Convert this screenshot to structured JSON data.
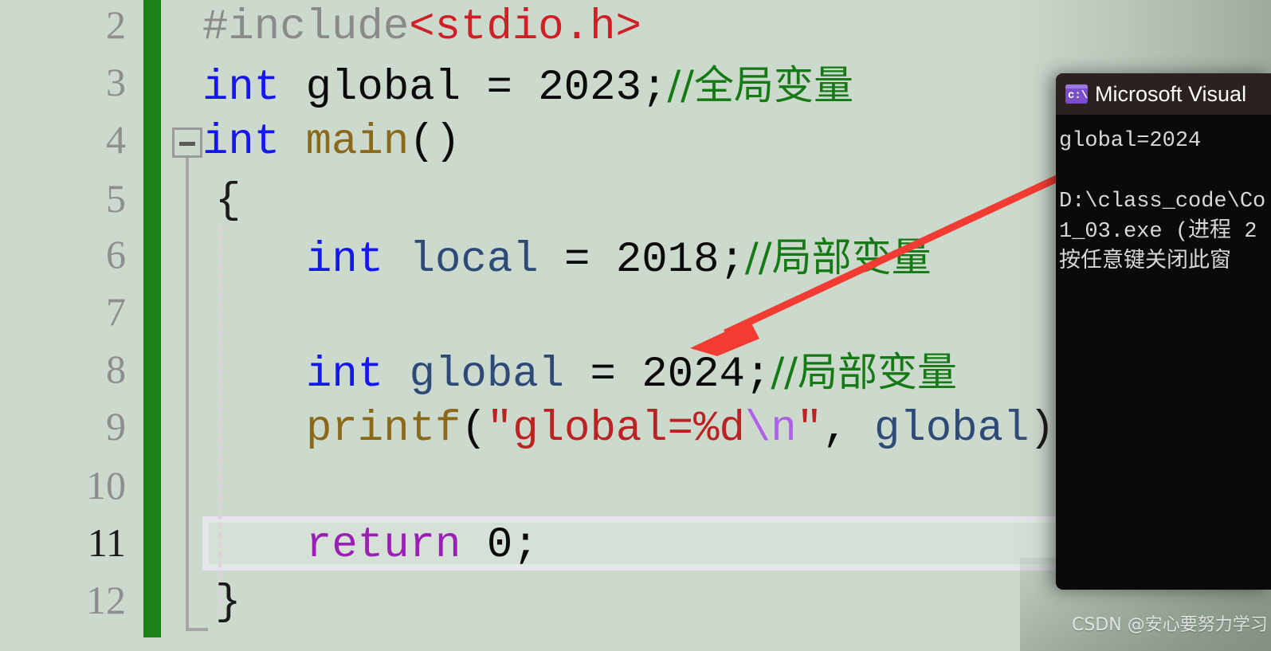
{
  "colors": {
    "editor_background": "#ccd9cd",
    "change_bar_green": "#1a8217",
    "keyword_blue": "#1616f0",
    "comment_green": "#157a15",
    "string_red": "#bb2222",
    "header_red": "#cf2027",
    "preprocessor_gray": "#8a8a8a",
    "variable_slate": "#2e4a77",
    "function_brown": "#8a6a1a",
    "control_purple": "#9b1fb5",
    "escape_violet": "#b060e8",
    "arrow_red": "#f23b32",
    "console_background": "#0a0a0a",
    "console_titlebar": "#2b211f"
  },
  "gutter": {
    "line_numbers": [
      "2",
      "3",
      "4",
      "5",
      "6",
      "7",
      "8",
      "9",
      "10",
      "11",
      "12"
    ],
    "current_line": "11"
  },
  "outline": {
    "fold_toggle_state": "expanded",
    "fold_toggle_glyph": "−"
  },
  "code": {
    "lines": [
      {
        "number": "2",
        "tokens": [
          {
            "text": "#include",
            "kind": "preprocessor"
          },
          {
            "text": "<stdio.h>",
            "kind": "header"
          }
        ]
      },
      {
        "number": "3",
        "tokens": [
          {
            "text": "int",
            "kind": "keyword"
          },
          {
            "text": " global = 2023;",
            "kind": "plain"
          },
          {
            "text": "//全局变量",
            "kind": "comment"
          }
        ]
      },
      {
        "number": "4",
        "tokens": [
          {
            "text": "int",
            "kind": "keyword"
          },
          {
            "text": " ",
            "kind": "plain"
          },
          {
            "text": "main",
            "kind": "function"
          },
          {
            "text": "()",
            "kind": "plain"
          }
        ]
      },
      {
        "number": "5",
        "tokens": [
          {
            "text": "{",
            "kind": "brace"
          }
        ]
      },
      {
        "number": "6",
        "tokens": [
          {
            "text": "int",
            "kind": "keyword"
          },
          {
            "text": " ",
            "kind": "plain"
          },
          {
            "text": "local",
            "kind": "variable"
          },
          {
            "text": " = 2018;",
            "kind": "plain"
          },
          {
            "text": "//局部变量",
            "kind": "comment"
          }
        ]
      },
      {
        "number": "7",
        "tokens": []
      },
      {
        "number": "8",
        "tokens": [
          {
            "text": "int",
            "kind": "keyword"
          },
          {
            "text": " ",
            "kind": "plain"
          },
          {
            "text": "global",
            "kind": "variable"
          },
          {
            "text": " = 2024;",
            "kind": "plain"
          },
          {
            "text": "//局部变量",
            "kind": "comment"
          }
        ]
      },
      {
        "number": "9",
        "tokens": [
          {
            "text": "printf",
            "kind": "function"
          },
          {
            "text": "(",
            "kind": "plain"
          },
          {
            "text": "\"global=%d",
            "kind": "string"
          },
          {
            "text": "\\n",
            "kind": "escape"
          },
          {
            "text": "\"",
            "kind": "string"
          },
          {
            "text": ", ",
            "kind": "plain"
          },
          {
            "text": "global",
            "kind": "variable"
          },
          {
            "text": ");",
            "kind": "plain"
          }
        ]
      },
      {
        "number": "10",
        "tokens": []
      },
      {
        "number": "11",
        "tokens": [
          {
            "text": "return",
            "kind": "control"
          },
          {
            "text": " 0;",
            "kind": "plain"
          }
        ]
      },
      {
        "number": "12",
        "tokens": [
          {
            "text": "}",
            "kind": "brace"
          }
        ]
      }
    ]
  },
  "console": {
    "title": "Microsoft Visual",
    "icon_name": "command-prompt-icon",
    "icon_glyph": "c:\\",
    "output_lines": [
      "global=2024",
      "",
      "D:\\class_code\\Co",
      "1_03.exe (进程 2",
      "按任意键关闭此窗"
    ]
  },
  "annotation": {
    "arrow_label": "points from console output to int global = 2024 line",
    "color": "#f23b32"
  },
  "watermark": {
    "text": "CSDN @安心要努力学习"
  }
}
